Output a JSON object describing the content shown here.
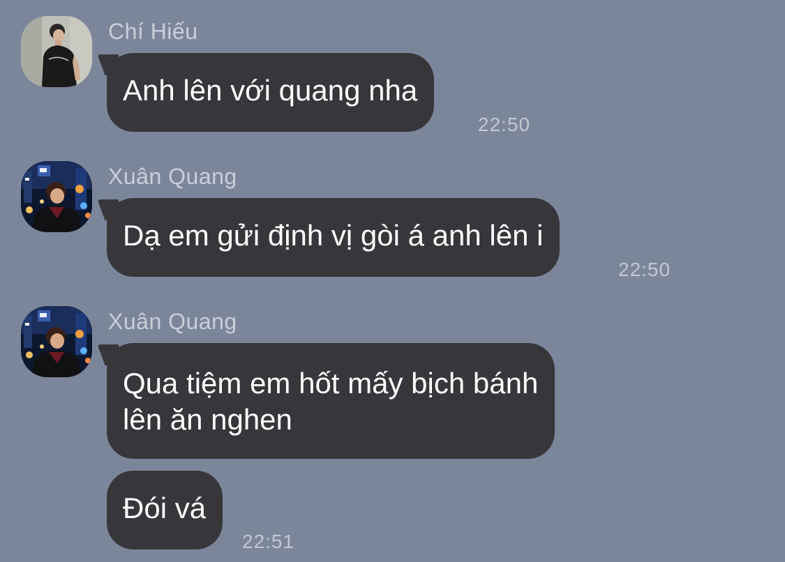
{
  "messages": [
    {
      "sender": "Chí Hiếu",
      "text": "Anh lên với quang nha",
      "time": "22:50"
    },
    {
      "sender": "Xuân Quang",
      "text": "Dạ em gửi định vị gòi á anh lên i",
      "time": "22:50"
    },
    {
      "sender": "Xuân Quang",
      "lines": [
        "Qua tiệm em hốt mấy bịch bánh",
        "lên ăn nghen"
      ]
    },
    {
      "text": "Đói vá",
      "time": "22:51"
    }
  ],
  "colors": {
    "background": "#7c869b",
    "bubble": "#37373b",
    "bubble_text": "#ffffff",
    "sender_name": "#c9ced8",
    "timestamp": "#c2c8d3"
  }
}
